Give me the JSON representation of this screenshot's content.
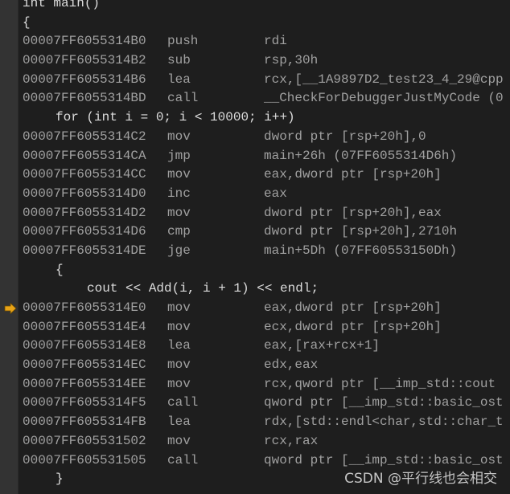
{
  "colors": {
    "background": "#1e1e1e",
    "gutter": "#333333",
    "source": "#dcdcdc",
    "asm": "#a0a0a0",
    "arrow": "#e8a317"
  },
  "lines": [
    {
      "type": "src",
      "indent": 0,
      "text": "int main()"
    },
    {
      "type": "src",
      "indent": 0,
      "text": "{"
    },
    {
      "type": "asm",
      "addr": "00007FF6055314B0",
      "mn": "push",
      "op": "rdi"
    },
    {
      "type": "asm",
      "addr": "00007FF6055314B2",
      "mn": "sub",
      "op": "rsp,30h"
    },
    {
      "type": "asm",
      "addr": "00007FF6055314B6",
      "mn": "lea",
      "op": "rcx,[__1A9897D2_test23_4_29@cpp"
    },
    {
      "type": "asm",
      "addr": "00007FF6055314BD",
      "mn": "call",
      "op": "__CheckForDebuggerJustMyCode (0"
    },
    {
      "type": "src",
      "indent": 1,
      "text": "for (int i = 0; i < 10000; i++)"
    },
    {
      "type": "asm",
      "addr": "00007FF6055314C2",
      "mn": "mov",
      "op": "dword ptr [rsp+20h],0"
    },
    {
      "type": "asm",
      "addr": "00007FF6055314CA",
      "mn": "jmp",
      "op": "main+26h (07FF6055314D6h)"
    },
    {
      "type": "asm",
      "addr": "00007FF6055314CC",
      "mn": "mov",
      "op": "eax,dword ptr [rsp+20h]"
    },
    {
      "type": "asm",
      "addr": "00007FF6055314D0",
      "mn": "inc",
      "op": "eax"
    },
    {
      "type": "asm",
      "addr": "00007FF6055314D2",
      "mn": "mov",
      "op": "dword ptr [rsp+20h],eax"
    },
    {
      "type": "asm",
      "addr": "00007FF6055314D6",
      "mn": "cmp",
      "op": "dword ptr [rsp+20h],2710h"
    },
    {
      "type": "asm",
      "addr": "00007FF6055314DE",
      "mn": "jge",
      "op": "main+5Dh (07FF60553150Dh)"
    },
    {
      "type": "src",
      "indent": 1,
      "text": "{"
    },
    {
      "type": "src",
      "indent": 2,
      "text": "cout << Add(i, i + 1) << endl;"
    },
    {
      "type": "asm",
      "addr": "00007FF6055314E0",
      "mn": "mov",
      "op": "eax,dword ptr [rsp+20h]",
      "current": true
    },
    {
      "type": "asm",
      "addr": "00007FF6055314E4",
      "mn": "mov",
      "op": "ecx,dword ptr [rsp+20h]"
    },
    {
      "type": "asm",
      "addr": "00007FF6055314E8",
      "mn": "lea",
      "op": "eax,[rax+rcx+1]"
    },
    {
      "type": "asm",
      "addr": "00007FF6055314EC",
      "mn": "mov",
      "op": "edx,eax"
    },
    {
      "type": "asm",
      "addr": "00007FF6055314EE",
      "mn": "mov",
      "op": "rcx,qword ptr [__imp_std::cout"
    },
    {
      "type": "asm",
      "addr": "00007FF6055314F5",
      "mn": "call",
      "op": "qword ptr [__imp_std::basic_ost"
    },
    {
      "type": "asm",
      "addr": "00007FF6055314FB",
      "mn": "lea",
      "op": "rdx,[std::endl<char,std::char_t"
    },
    {
      "type": "asm",
      "addr": "00007FF605531502",
      "mn": "mov",
      "op": "rcx,rax"
    },
    {
      "type": "asm",
      "addr": "00007FF605531505",
      "mn": "call",
      "op": "qword ptr [__imp_std::basic_ost"
    },
    {
      "type": "src",
      "indent": 1,
      "text": "}"
    }
  ],
  "watermark": "CSDN @平行线也会相交",
  "current_instruction_icon": "arrow-right-icon"
}
